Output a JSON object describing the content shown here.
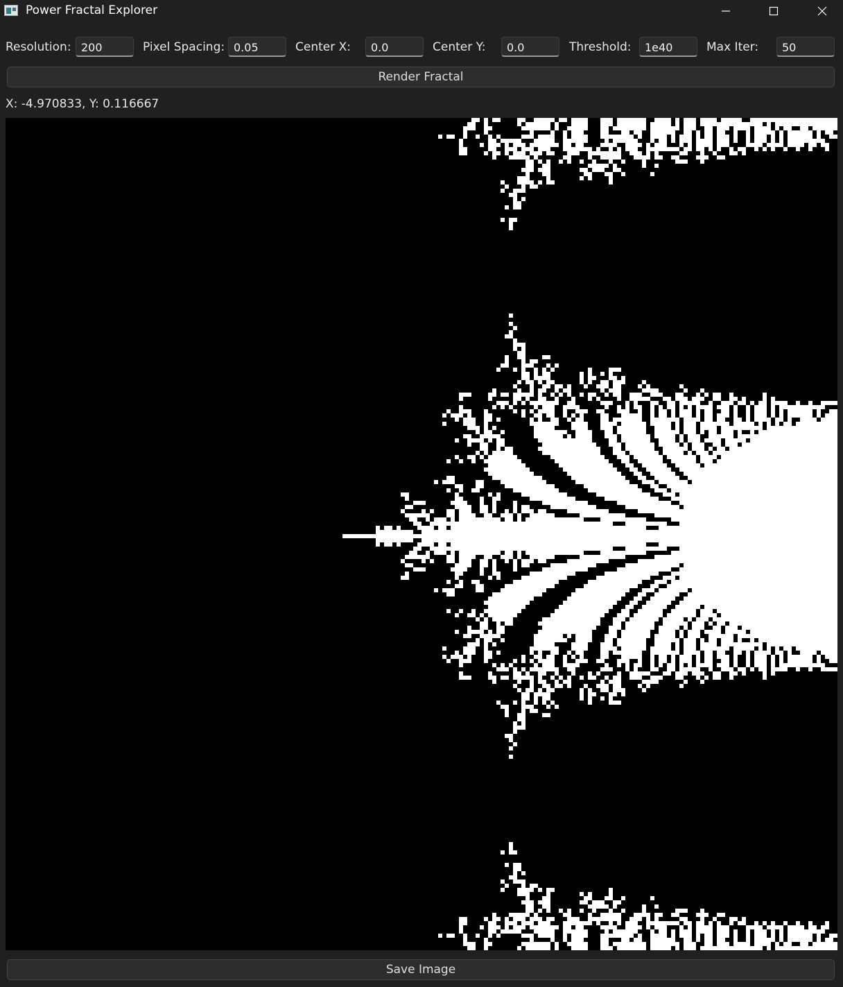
{
  "window": {
    "title": "Power Fractal Explorer",
    "icon": "app-icon"
  },
  "controls": {
    "resolution_label": "Resolution:",
    "resolution_value": "200",
    "pixel_spacing_label": "Pixel Spacing:",
    "pixel_spacing_value": "0.05",
    "center_x_label": "Center X:",
    "center_x_value": "0.0",
    "center_y_label": "Center Y:",
    "center_y_value": "0.0",
    "threshold_label": "Threshold:",
    "threshold_value": "1e40",
    "max_iter_label": "Max Iter:",
    "max_iter_value": "50"
  },
  "buttons": {
    "render_label": "Render Fractal",
    "save_label": "Save Image"
  },
  "status": {
    "coords_text": "X: -4.970833, Y: 0.116667"
  },
  "fractal": {
    "background_color": "#000000",
    "point_color": "#ffffff"
  }
}
